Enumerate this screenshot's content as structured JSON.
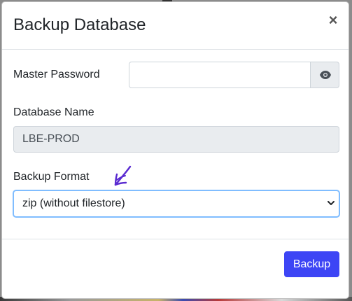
{
  "dialog": {
    "title": "Backup Database",
    "close_label": "×"
  },
  "fields": {
    "master_password": {
      "label": "Master Password",
      "value": ""
    },
    "database_name": {
      "label": "Database Name",
      "value": "LBE-PROD"
    },
    "backup_format": {
      "label": "Backup Format",
      "selected": "zip (without filestore)"
    }
  },
  "footer": {
    "backup_label": "Backup"
  },
  "icons": {
    "password_toggle": "eye-icon",
    "select_arrow": "chevron-down-icon",
    "close": "close-icon",
    "annotation": "hand-drawn-arrow-icon"
  },
  "colors": {
    "primary_button": "#3d45f5",
    "annotation": "#5a2bd1",
    "focus_border": "#80bdff",
    "readonly_bg": "#e9ecef"
  }
}
